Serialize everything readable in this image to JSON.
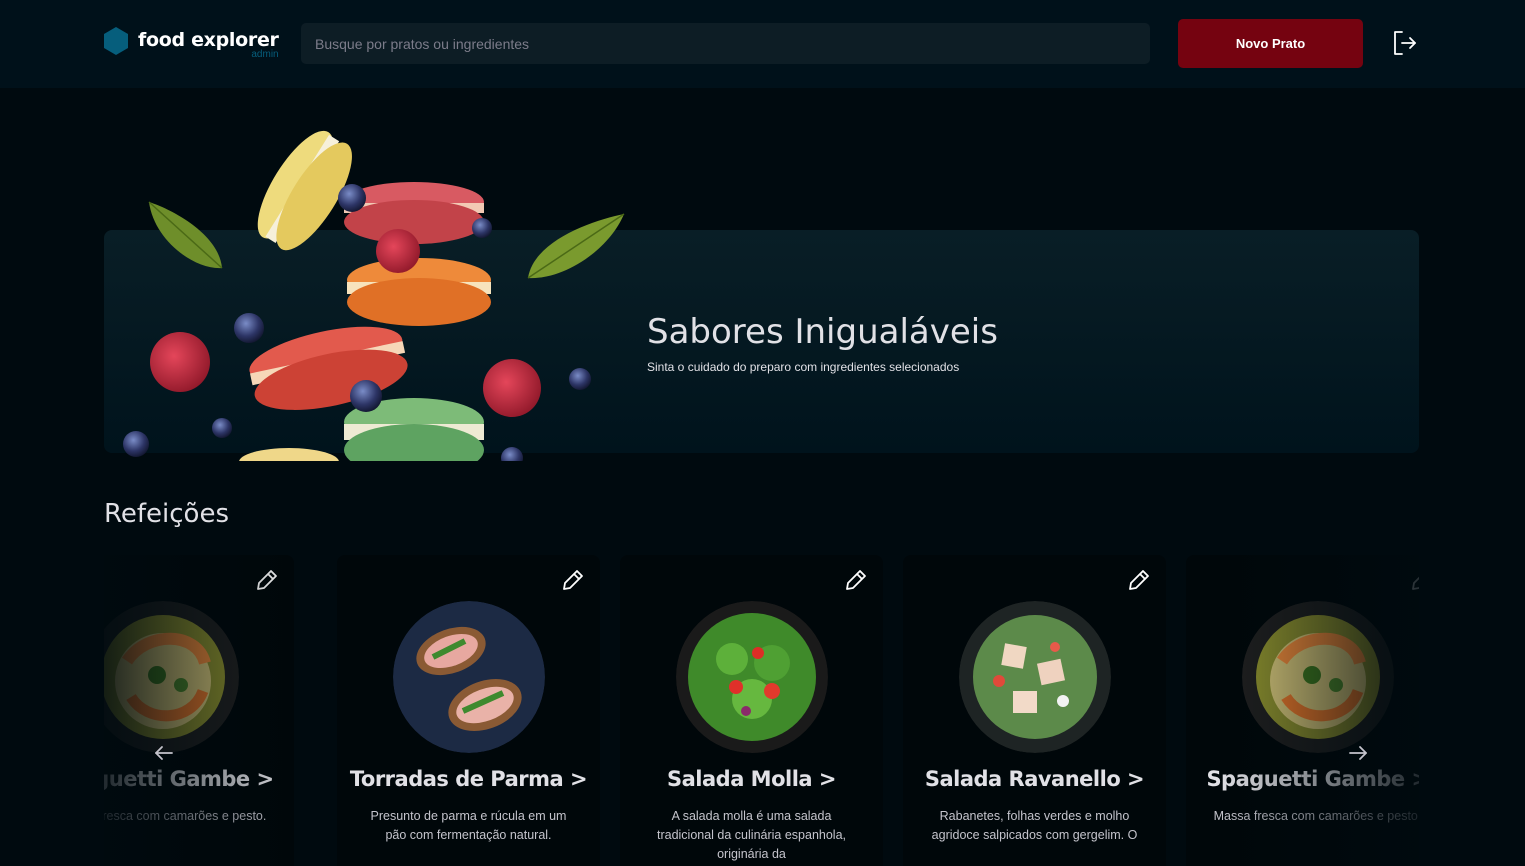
{
  "header": {
    "logo_title": "food explorer",
    "logo_badge": "admin",
    "search_placeholder": "Busque por pratos ou ingredientes",
    "new_dish_label": "Novo Prato",
    "logout_icon": "sign-out-icon"
  },
  "banner": {
    "title": "Sabores Inigualáveis",
    "subtitle": "Sinta o cuidado do preparo com ingredientes selecionados"
  },
  "section": {
    "title": "Refeições"
  },
  "cards": [
    {
      "name": "Spaguetti Gambe >",
      "description": "Massa fresca com camarões e pesto."
    },
    {
      "name": "Torradas de Parma >",
      "description": "Presunto de parma e rúcula em um pão com fermentação natural."
    },
    {
      "name": "Salada Molla >",
      "description": "A salada molla é uma salada tradicional da culinária espanhola, originária da"
    },
    {
      "name": "Salada Ravanello >",
      "description": "Rabanetes, folhas verdes e molho agridoce salpicados com gergelim. O"
    },
    {
      "name": "Spaguetti Gambe >",
      "description": "Massa fresca com camarões e pesto."
    }
  ],
  "colors": {
    "background": "#000A0F",
    "header": "#00111A",
    "accent_button": "#750310",
    "logo": "#065E7C"
  }
}
